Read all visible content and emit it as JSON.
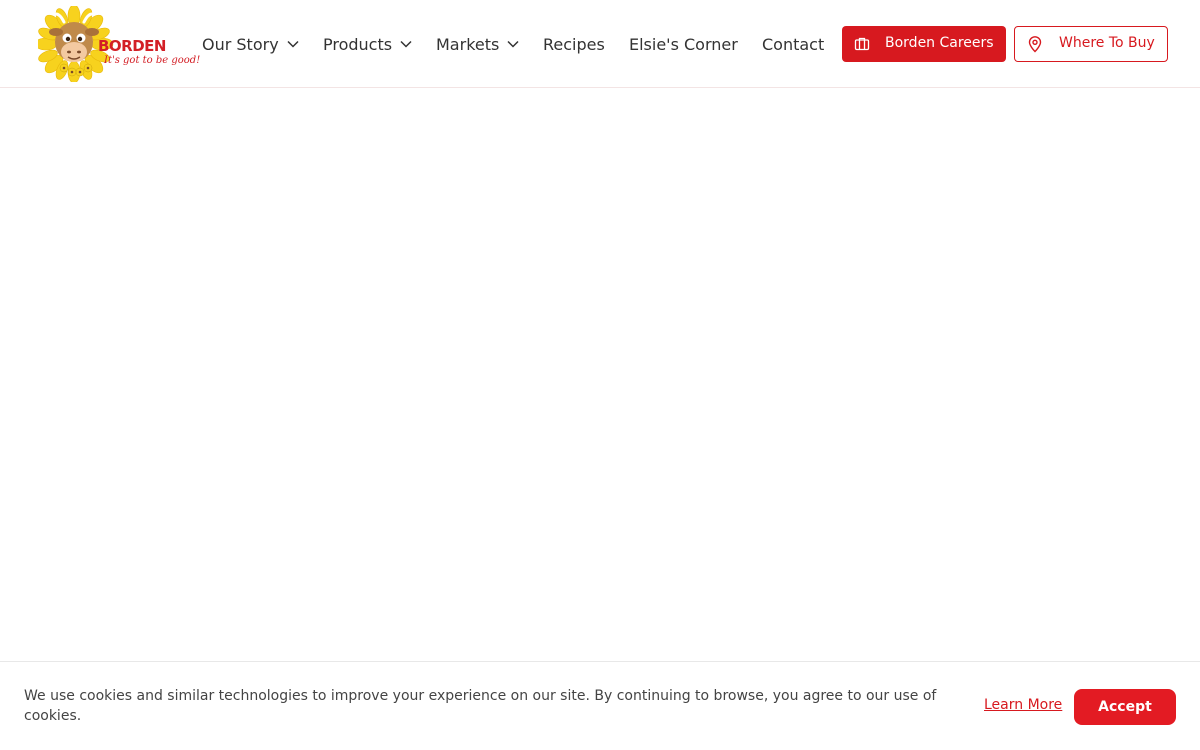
{
  "header": {
    "logo": {
      "wordmark": "BORDEN",
      "tagline": "It's got to be good!",
      "alt": "Borden logo"
    },
    "nav": [
      {
        "label": "Our Story",
        "has_dropdown": true,
        "icon": "chevron-down-icon"
      },
      {
        "label": "Products",
        "has_dropdown": true,
        "icon": "chevron-down-icon"
      },
      {
        "label": "Markets",
        "has_dropdown": true,
        "icon": "chevron-down-icon"
      },
      {
        "label": "Recipes",
        "has_dropdown": false
      },
      {
        "label": "Elsie's Corner",
        "has_dropdown": false
      },
      {
        "label": "Contact",
        "has_dropdown": false
      }
    ],
    "careers_button": {
      "label": "Borden Careers",
      "icon": "briefcase-icon"
    },
    "where_to_buy_button": {
      "label": "Where To Buy",
      "icon": "map-pin-icon"
    }
  },
  "cookie_banner": {
    "message": "We use cookies and similar technologies to improve your experience on our site. By continuing to browse, you agree to our use of cookies.",
    "learn_more": "Learn More",
    "accept": "Accept"
  },
  "colors": {
    "brand_red": "#d7191f",
    "text": "#333333",
    "logo_yellow": "#f7d21e",
    "background": "#ffffff"
  }
}
